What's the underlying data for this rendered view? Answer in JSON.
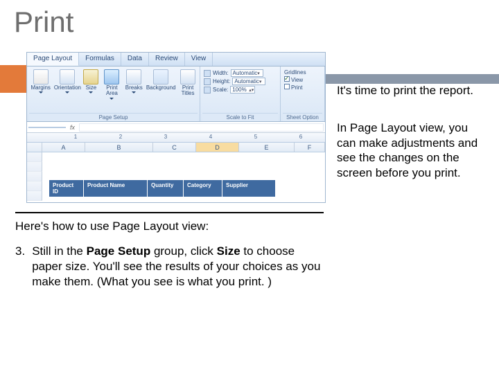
{
  "slide": {
    "title": "Print"
  },
  "ribbon": {
    "tabs": [
      "Page Layout",
      "Formulas",
      "Data",
      "Review",
      "View"
    ],
    "active_tab": 0,
    "page_setup": {
      "label": "Page Setup",
      "margins": "Margins",
      "orientation": "Orientation",
      "size": "Size",
      "print_area": "Print Area",
      "breaks": "Breaks",
      "background": "Background",
      "print_titles": "Print Titles"
    },
    "scale_to_fit": {
      "label": "Scale to Fit",
      "width_label": "Width:",
      "width_value": "Automatic",
      "height_label": "Height:",
      "height_value": "Automatic",
      "scale_label": "Scale:",
      "scale_value": "100%"
    },
    "sheet_options": {
      "label": "Sheet Option",
      "gridlines_label": "Gridlines",
      "view_label": "View",
      "print_label": "Print"
    }
  },
  "formula_bar": {
    "name_box": "",
    "fx": "fx"
  },
  "ruler": {
    "numbers": [
      "1",
      "2",
      "3",
      "4",
      "5",
      "6"
    ]
  },
  "columns": [
    "A",
    "B",
    "C",
    "D",
    "E",
    "F"
  ],
  "selected_column_index": 3,
  "table": {
    "headers": [
      "Product ID",
      "Product Name",
      "Quantity",
      "Category",
      "Supplier"
    ]
  },
  "right_text": {
    "p1": "It's time to print the report.",
    "p2": "In Page Layout view, you can make adjustments and see the changes on the screen before you print."
  },
  "below_text": {
    "lead": "Here's how to use Page Layout view:",
    "step_number": "3.",
    "step_prefix": "Still in the ",
    "step_bold1": "Page Setup",
    "step_mid1": " group, click ",
    "step_bold2": "Size",
    "step_mid2": " to choose paper size. You'll see the results of your choices as you make them. (What you see is what you print. )"
  }
}
